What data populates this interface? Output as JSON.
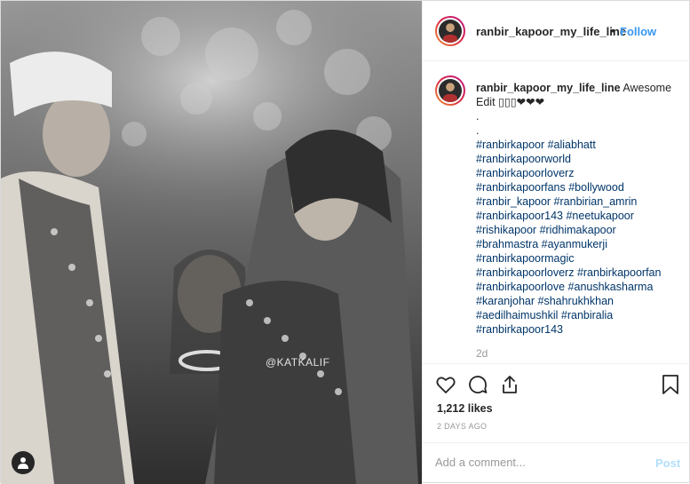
{
  "post": {
    "username": "ranbir_kapoor_my_life_line",
    "follow_label": "Follow",
    "dot": "•",
    "watermark": "@KATKALIF"
  },
  "caption": {
    "username": "ranbir_kapoor_my_life_line",
    "text": "Awesome Edit ▯▯▯❤❤❤",
    "lines": [
      ".",
      "."
    ],
    "hashtags": [
      "#ranbirkapoor #aliabhatt",
      "#ranbirkapoorworld",
      "#ranbirkapoorloverz",
      "#ranbirkapoorfans #bollywood",
      "#ranbir_kapoor #ranbirian_amrin",
      "#ranbirkapoor143 #neetukapoor",
      "#rishikapoor #ridhimakapoor",
      "#brahmastra #ayanmukerji",
      "#ranbirkapoormagic",
      "#ranbirkapoorloverz #ranbirkapoorfan",
      "#ranbirkapoorlove #anushkasharma",
      "#karanjohar #shahrukhkhan",
      "#aedilhaimushkil #ranbiralia",
      "#ranbirkapoor143"
    ],
    "time_ago": "2d"
  },
  "stats": {
    "likes": "1,212 likes",
    "date": "2 DAYS AGO"
  },
  "comment": {
    "placeholder": "Add a comment...",
    "post_label": "Post"
  },
  "icons": {
    "like": "heart-icon",
    "comment": "comment-icon",
    "share": "share-icon",
    "save": "bookmark-icon",
    "tag": "user-tag-icon"
  },
  "colors": {
    "link_blue": "#3897f0",
    "hashtag": "#003569",
    "muted": "#999999",
    "post_disabled": "#b2dffc"
  }
}
